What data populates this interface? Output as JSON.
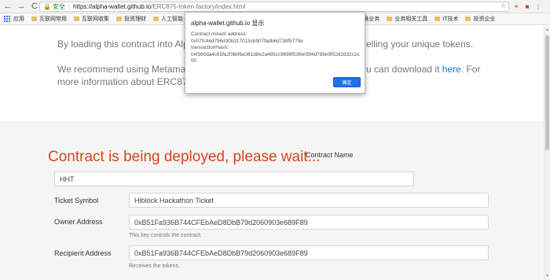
{
  "browser": {
    "secure_label": "安全",
    "url_host": "https://alpha-wallet.github.io",
    "url_path": "/ERC875-token-factory/index.html",
    "nav": {
      "back": "←",
      "forward": "→",
      "reload": "C"
    }
  },
  "bookmarks": [
    {
      "label": "应用"
    },
    {
      "label": "互联网常用"
    },
    {
      "label": "互联网收集"
    },
    {
      "label": "投资理财"
    },
    {
      "label": "人工智能"
    },
    {
      "label": "P2P跨境业务"
    },
    {
      "label": "业务相关工具"
    },
    {
      "label": "IT技术"
    },
    {
      "label": "投资企业"
    }
  ],
  "page": {
    "intro_left": "By loading this contract into AlphaW",
    "intro_right": "elling your unique tokens.",
    "recommend_left": "We recommend using Metamask to",
    "recommend_right_prefix": "u can download it ",
    "recommend_link": "here",
    "recommend_right_suffix": ". For",
    "more_info": "more information about ERC875 cli",
    "deploy_title": "Contract is being deployed, please wait...",
    "contract_name_label": "Contract Name",
    "contract_name_value": "HHT",
    "ticket_symbol_label": "Ticket Symbol",
    "ticket_symbol_value": "Hiblock Hackathon Ticket",
    "owner_address_label": "Owner Address",
    "owner_address_value": "0xB51Fa936B744CFEbAeD8DbB79d2060903e689F89",
    "owner_help": "This key controls the contract.",
    "recipient_address_label": "Recipient Address",
    "recipient_address_value": "0xB51Fa936B744CFEbAeD8DbB79d2060903e689F89",
    "recipient_help": "Receives the tokens."
  },
  "dialog": {
    "title": "alpha-wallet.github.io 显示",
    "line1": "Contract mined! address:",
    "line2": "0x07fc44d796d30b317013cb907fadb6d738f5779e",
    "line3": "transactionHash:",
    "line4": "0xf360da4c65fa206bf6a361d8e2a485cc9896f536e05f4d789e9f52d2d32c2c00",
    "ok_label": "确定"
  }
}
